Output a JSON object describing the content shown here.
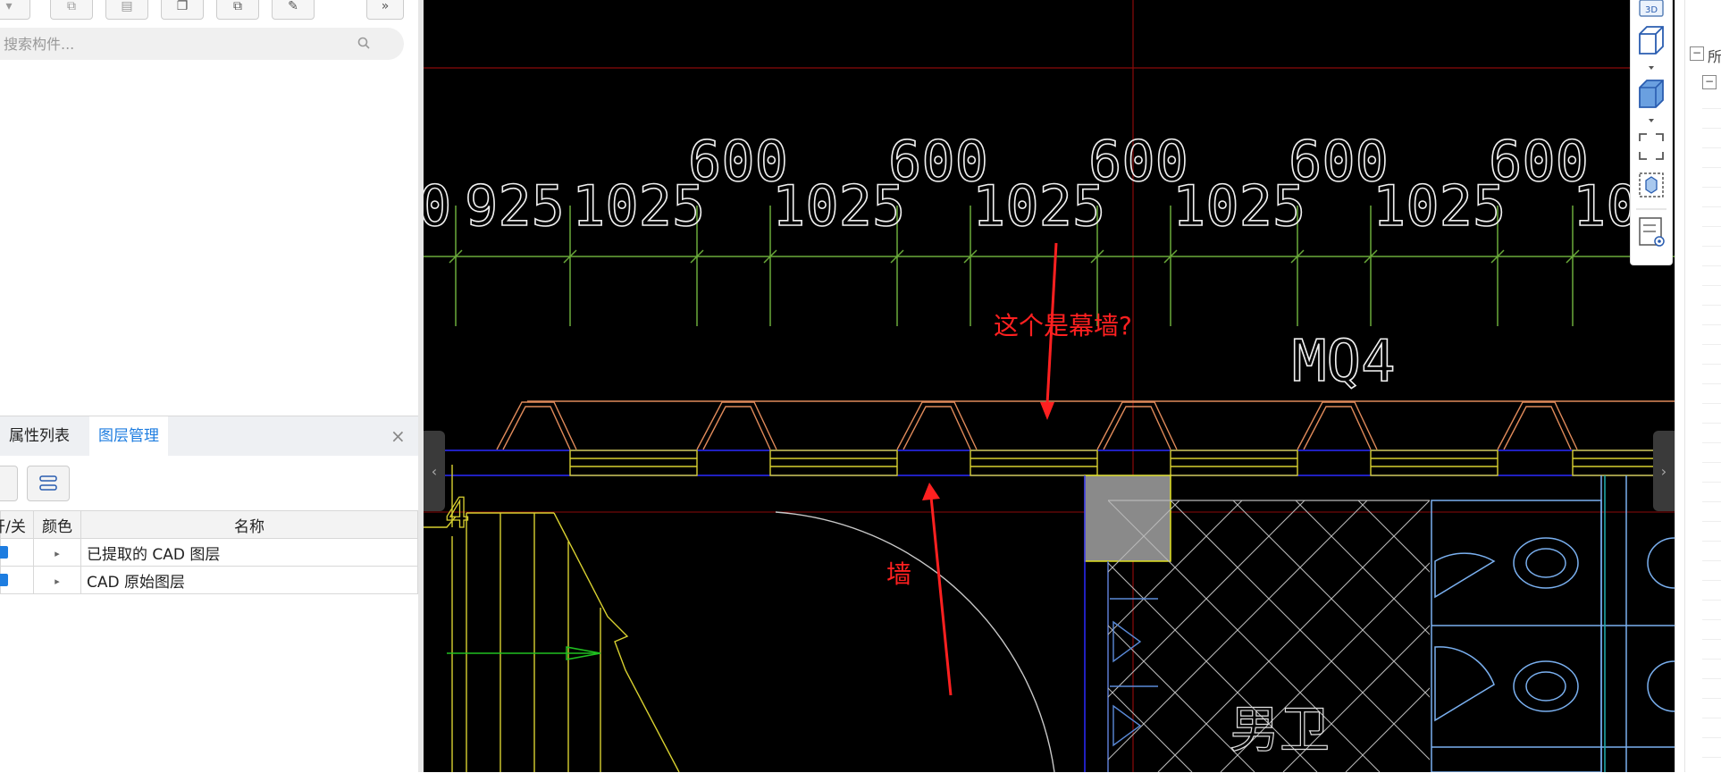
{
  "search": {
    "placeholder": "搜索构件..."
  },
  "panel": {
    "tabs": [
      "属性列表",
      "图层管理"
    ],
    "close_label": "×",
    "columns": [
      "开/关",
      "颜色",
      "名称"
    ],
    "rows": [
      {
        "checked": true,
        "name": "已提取的 CAD 图层"
      },
      {
        "checked": true,
        "name": "CAD 原始图层"
      }
    ]
  },
  "drawing": {
    "dims_top": [
      "600",
      "600",
      "600",
      "600",
      "600"
    ],
    "dims_bottom": [
      "0",
      "925",
      "1025",
      "1025",
      "1025",
      "1025",
      "1025",
      "10"
    ],
    "tag_mq": "MQ4",
    "room_label": "男卫",
    "annotation_curtain_wall": "这个是幕墙?",
    "annotation_wall": "墙",
    "left_num": "4"
  },
  "right_tools": {
    "view3d_label": "3D"
  },
  "colors": {
    "accent": "#1e7de0",
    "annotation": "#ff2020"
  }
}
